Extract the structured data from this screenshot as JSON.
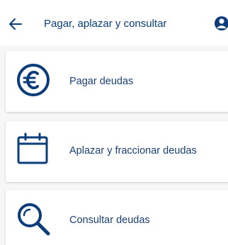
{
  "header": {
    "title": "Pagar, aplazar y consultar",
    "back_icon": "arrow-left-icon",
    "account_icon": "user-icon"
  },
  "menu": {
    "items": [
      {
        "label": "Pagar deudas",
        "icon": "euro-icon"
      },
      {
        "label": "Aplazar y fraccionar deudas",
        "icon": "calendar-icon"
      },
      {
        "label": "Consultar deudas",
        "icon": "magnifier-icon"
      }
    ]
  },
  "colors": {
    "primary": "#0b3d7a",
    "text": "#1a3f73",
    "background": "#f7f7f7",
    "card": "#ffffff"
  }
}
